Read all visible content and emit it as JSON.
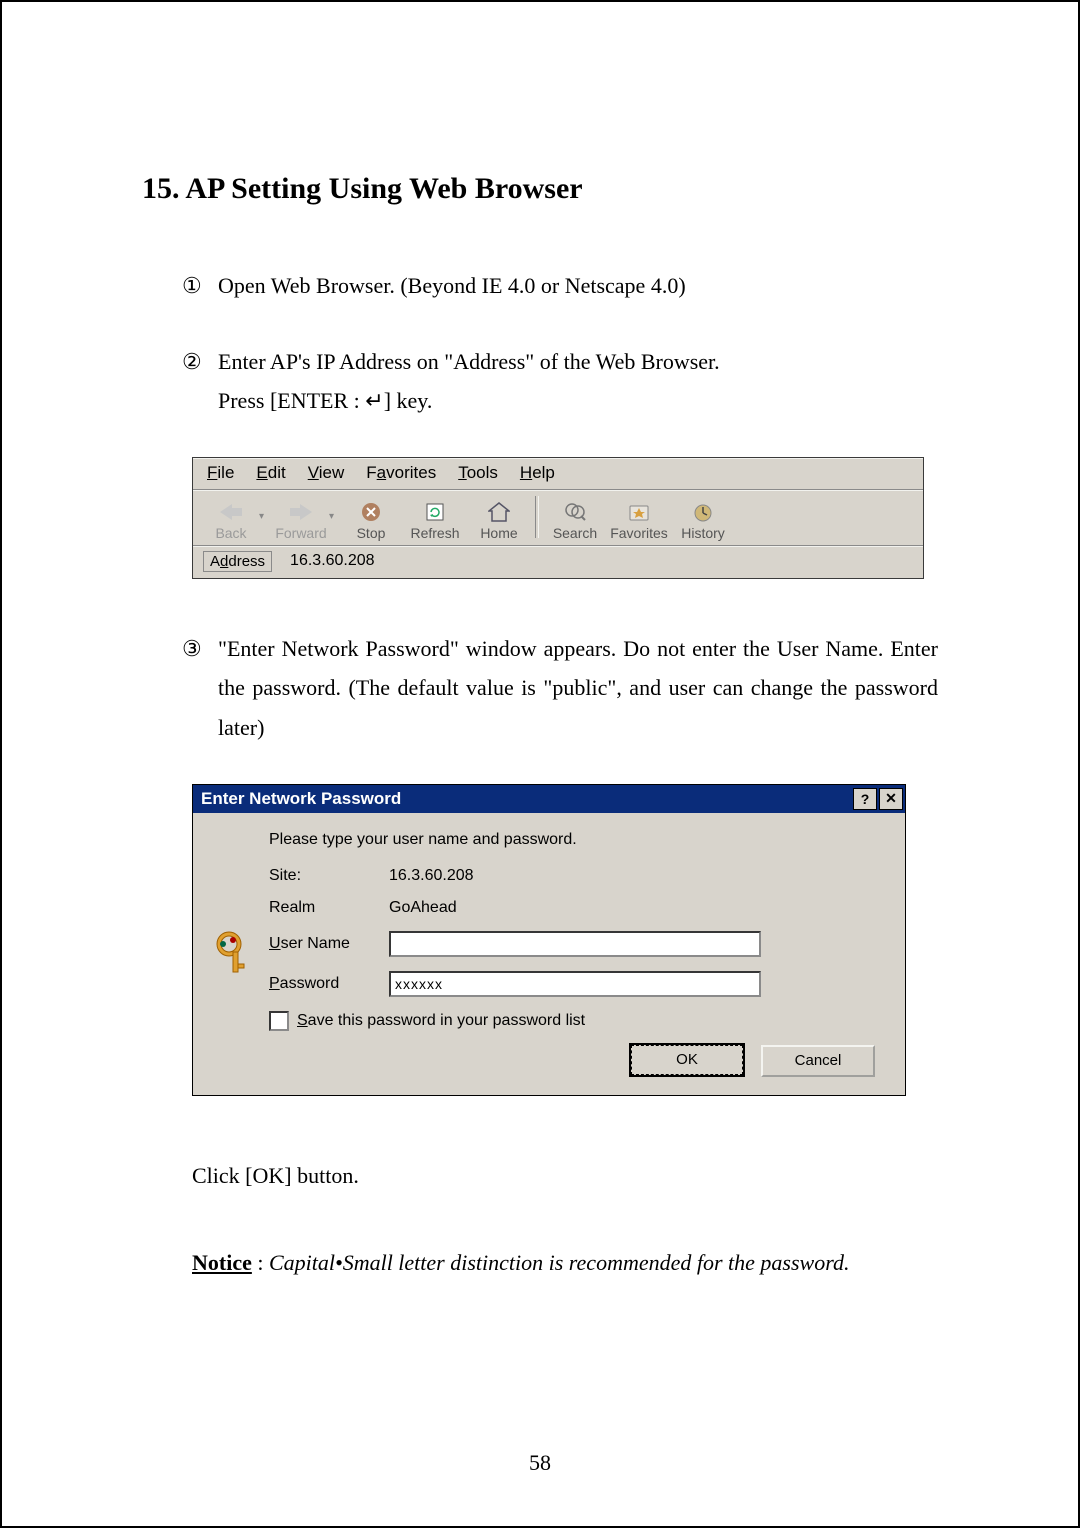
{
  "heading": "15. AP Setting Using Web Browser",
  "steps": {
    "s1": {
      "num": "①",
      "text": "Open Web Browser. (Beyond IE 4.0 or Netscape 4.0)"
    },
    "s2": {
      "num": "②",
      "line1": "Enter AP's IP Address on \"Address\" of the Web Browser.",
      "line2": "Press [ENTER : ↵] key."
    },
    "s3": {
      "num": "③",
      "text": "\"Enter Network Password\" window appears. Do not enter the User Name. Enter the password. (The default value is \"public\", and user can change the password later)"
    }
  },
  "browser": {
    "menus": {
      "file": "File",
      "edit": "Edit",
      "view": "View",
      "favorites": "Favorites",
      "tools": "Tools",
      "help": "Help"
    },
    "toolbar": {
      "back": "Back",
      "forward": "Forward",
      "stop": "Stop",
      "refresh": "Refresh",
      "home": "Home",
      "search": "Search",
      "favorites": "Favorites",
      "history": "History"
    },
    "address_label": "Address",
    "address_value": "16.3.60.208"
  },
  "dialog": {
    "title": "Enter Network Password",
    "msg": "Please type your user name and password.",
    "site_label": "Site:",
    "site_value": "16.3.60.208",
    "realm_label": "Realm",
    "realm_value": "GoAhead",
    "user_label": "User Name",
    "user_value": "",
    "password_label": "Password",
    "password_value": "xxxxxx",
    "save_label": "Save this password in your password list",
    "ok_label": "OK",
    "cancel_label": "Cancel"
  },
  "post": {
    "click_ok": "Click [OK] button.",
    "notice_label": "Notice",
    "notice_colon": " : ",
    "notice_text": "Capital•Small letter distinction is recommended for the password."
  },
  "page_number": "58",
  "chart_data": null
}
